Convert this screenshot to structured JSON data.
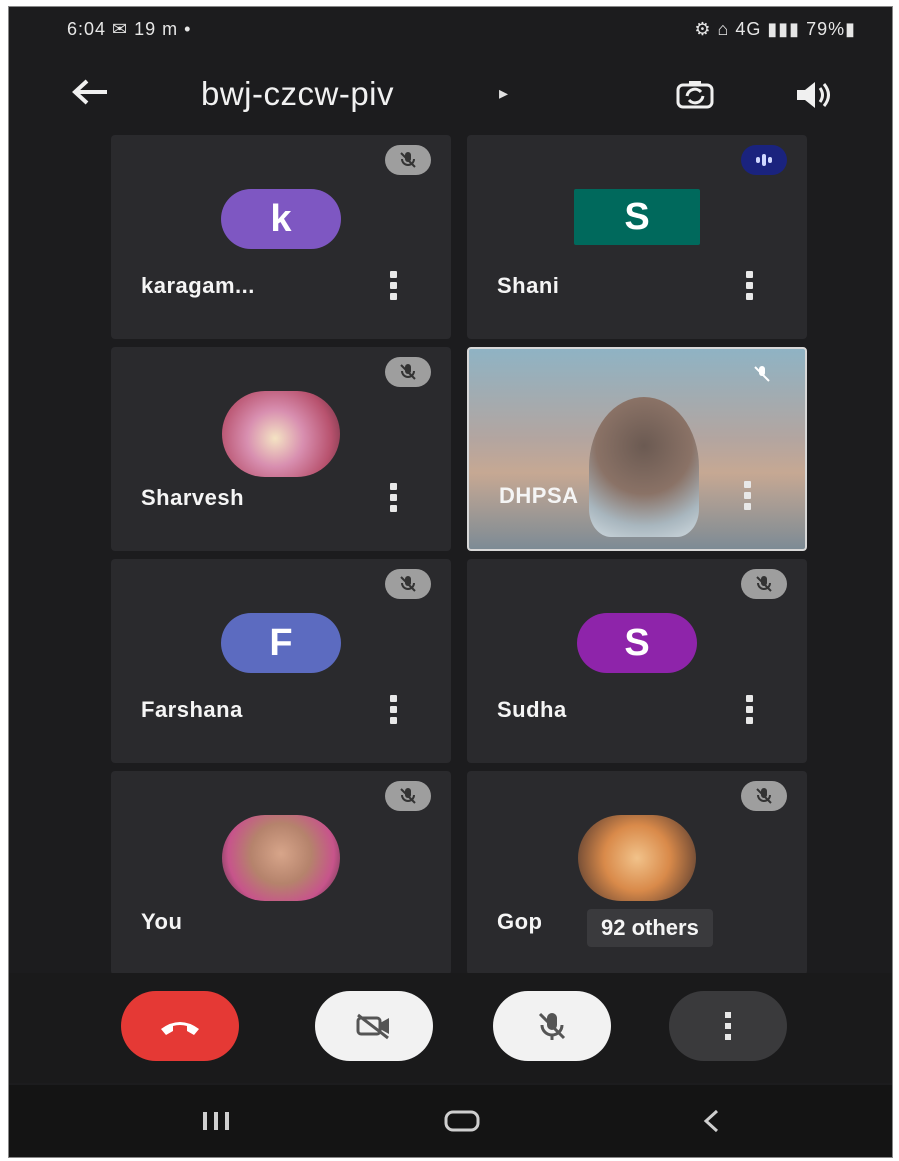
{
  "status_bar": {
    "time_left": "6:04 ✉ 19 m •",
    "indicators_right": "⚙ ⌂ 4G ▮▮▮ 79%▮"
  },
  "header": {
    "meeting_code": "bwj-czcw-piv",
    "caret": "▸",
    "icons": [
      "back-arrow-icon",
      "switch-camera-icon",
      "speaker-icon"
    ]
  },
  "participants": [
    {
      "name": "karagam...",
      "initial": "k",
      "avatar_color": "#7e57c2",
      "mic": "muted"
    },
    {
      "name": "Shani",
      "initial": "S",
      "avatar_color": "#00695c",
      "mic": "speaking"
    },
    {
      "name": "Sharvesh",
      "initial": "",
      "avatar_color": "#c76b8a",
      "mic": "muted"
    },
    {
      "name": "DHPSA",
      "initial": "",
      "avatar_color": "#8fb3c4",
      "mic": "muted"
    },
    {
      "name": "Farshana",
      "initial": "F",
      "avatar_color": "#5c6bc0",
      "mic": "muted"
    },
    {
      "name": "Sudha",
      "initial": "S",
      "avatar_color": "#8e24aa",
      "mic": "muted"
    },
    {
      "name": "You",
      "initial": "",
      "avatar_color": "#b5836c",
      "mic": "muted"
    },
    {
      "name": "Gop",
      "initial": "",
      "avatar_color": "#d98a4a",
      "mic": "muted"
    }
  ],
  "others_label": "92 others",
  "controls": {
    "end_call_color": "#e53935",
    "icons": [
      "end-call-icon",
      "camera-off-icon",
      "mic-off-icon",
      "more-options-icon"
    ]
  },
  "nav": {
    "icons": [
      "recents-icon",
      "home-icon",
      "back-nav-icon"
    ]
  }
}
